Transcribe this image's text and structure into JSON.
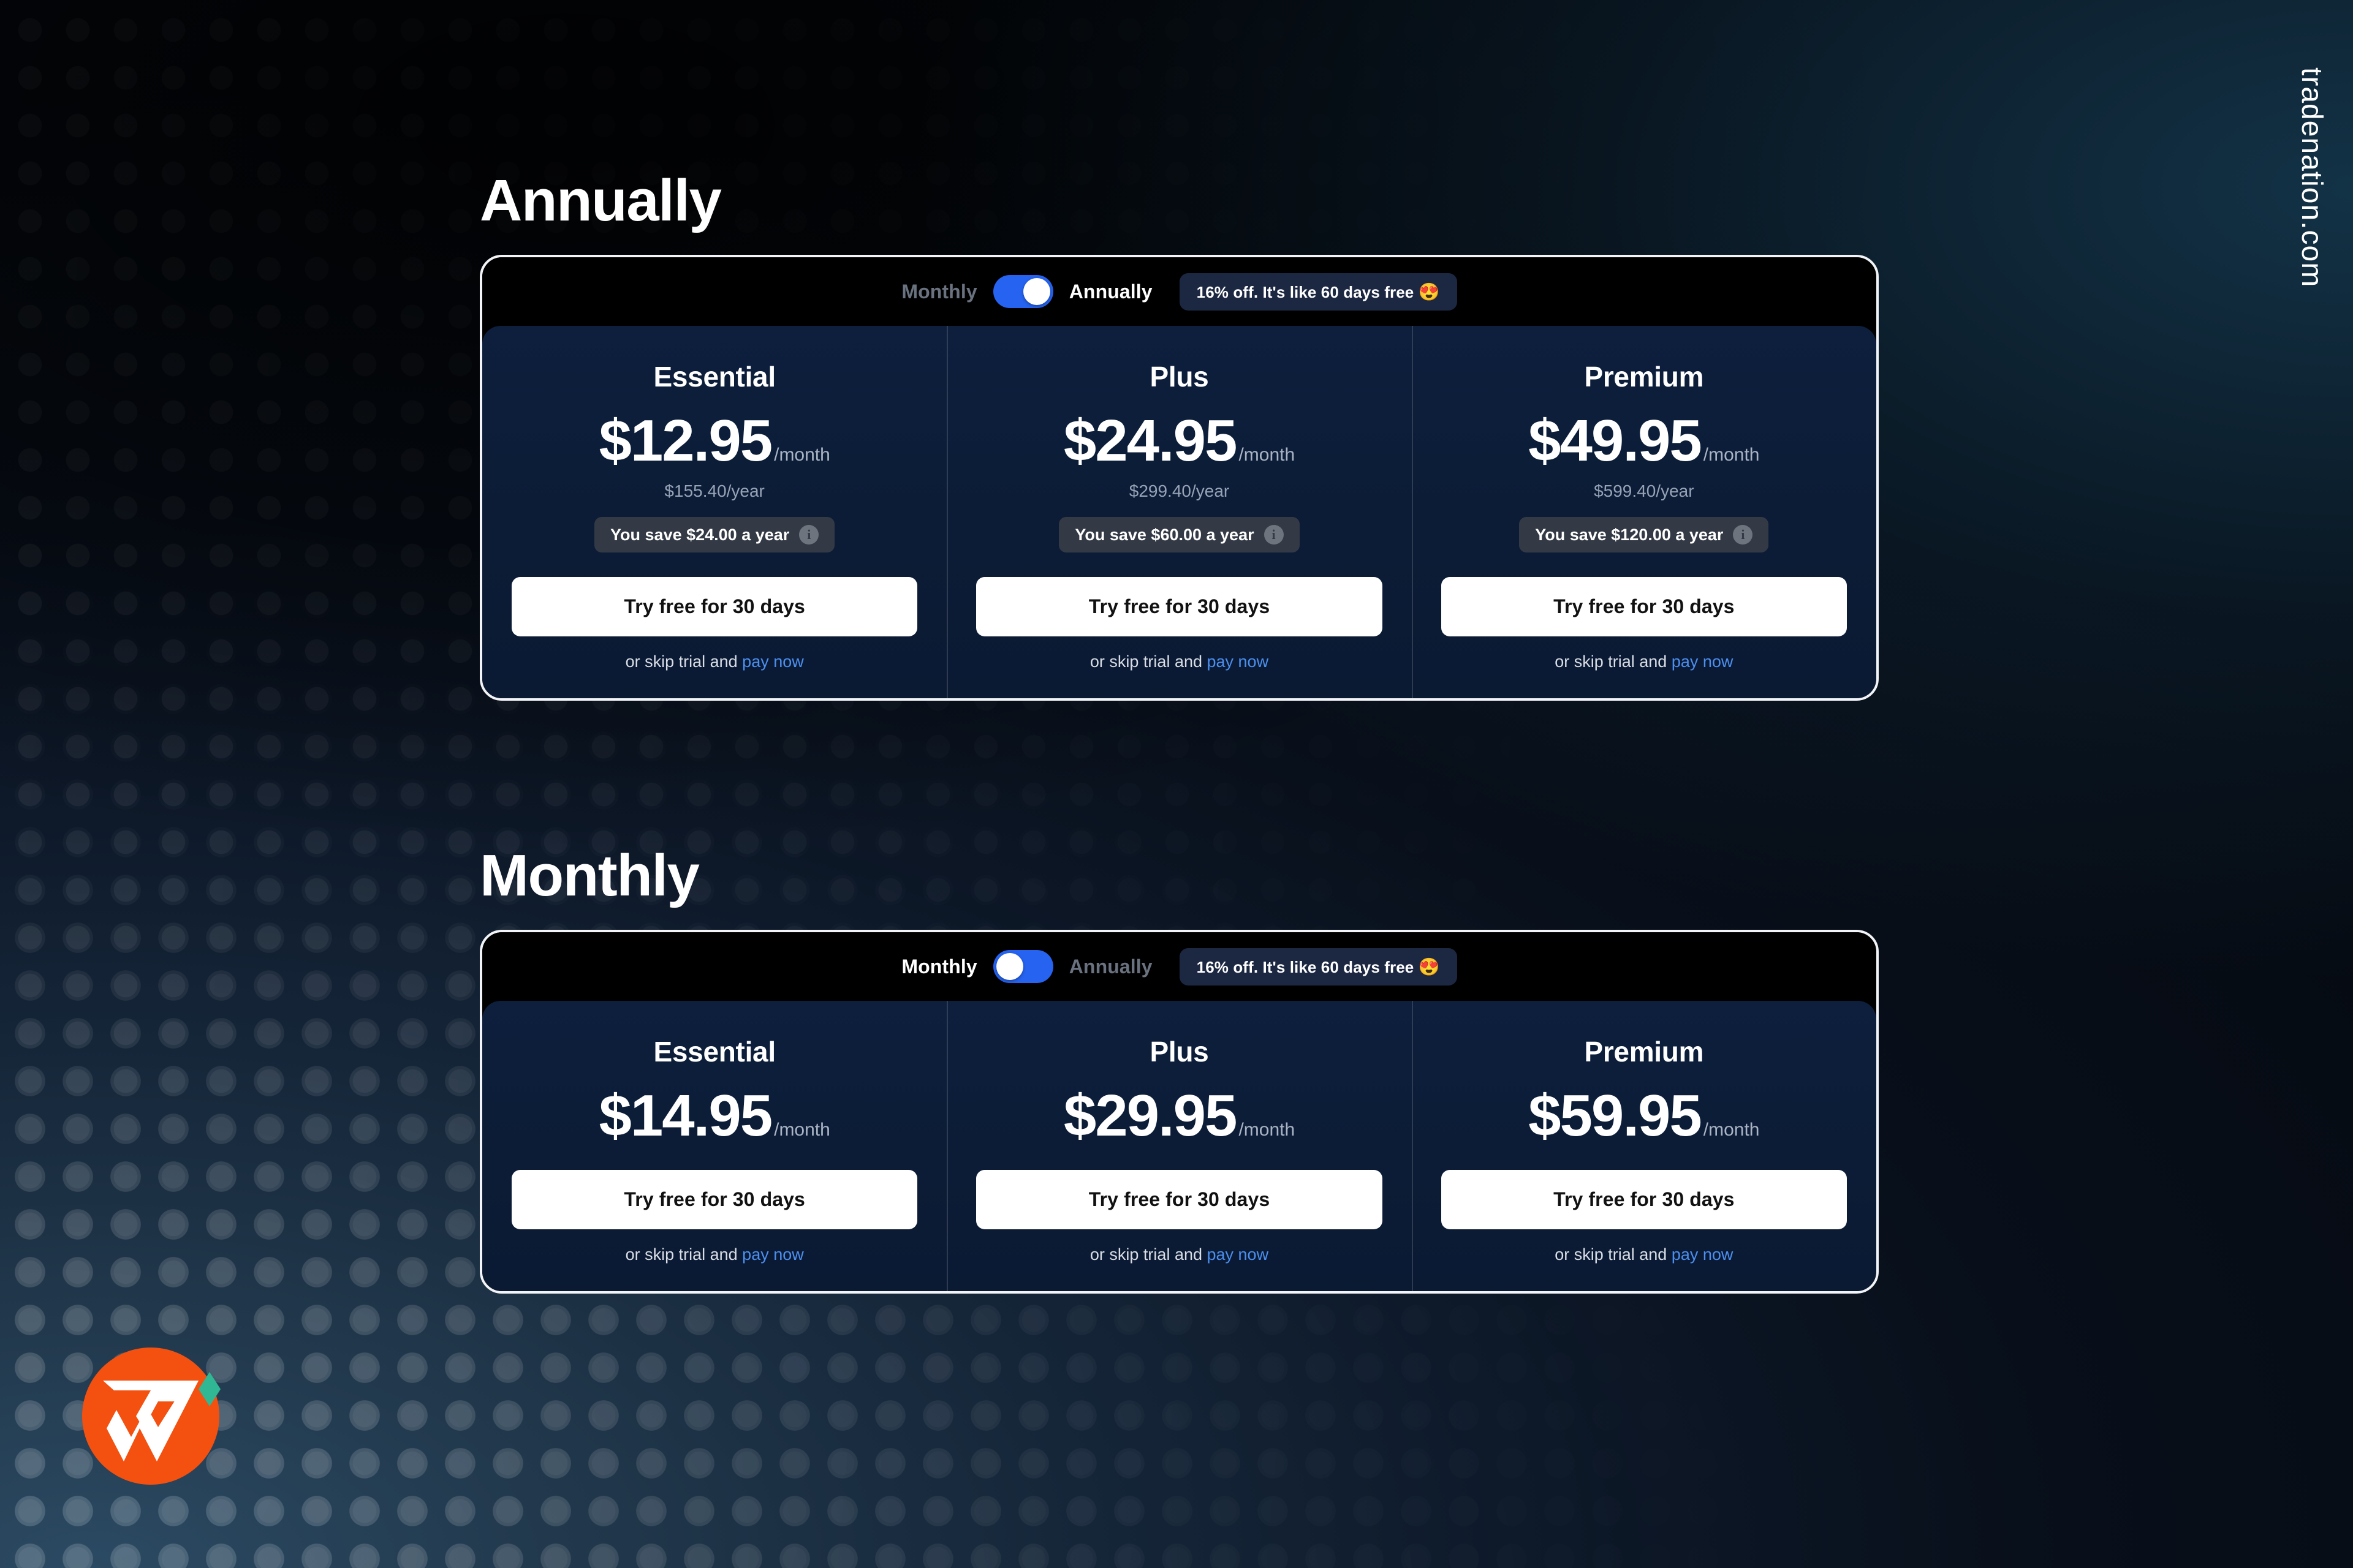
{
  "site_label": "tradenation.com",
  "logo": {
    "name": "tradenation-logo",
    "monogram": "TN",
    "circle_color": "#f4500f",
    "accent_color": "#2fb893"
  },
  "colors": {
    "accent_blue": "#2563f0",
    "link_blue": "#4b8ff0",
    "card_navy": "#0d1f3d",
    "toggle_bar_black": "#000000",
    "badge_navy": "#1c2742",
    "savings_gray": "#333a45",
    "cta_white": "#ffffff"
  },
  "sections": [
    {
      "heading": "Annually",
      "toggle": {
        "left_label": "Monthly",
        "right_label": "Annually",
        "state": "annually",
        "promo_badge": "16% off. It's like 60 days free",
        "promo_emoji": "😍"
      },
      "plans": [
        {
          "name": "Essential",
          "price": "$12.95",
          "period": "/month",
          "yearly": "$155.40/year",
          "savings": "You save $24.00 a year",
          "cta": "Try free for 30 days",
          "skip_prefix": "or skip trial and ",
          "skip_link": "pay now"
        },
        {
          "name": "Plus",
          "price": "$24.95",
          "period": "/month",
          "yearly": "$299.40/year",
          "savings": "You save $60.00 a year",
          "cta": "Try free for 30 days",
          "skip_prefix": "or skip trial and ",
          "skip_link": "pay now"
        },
        {
          "name": "Premium",
          "price": "$49.95",
          "period": "/month",
          "yearly": "$599.40/year",
          "savings": "You save $120.00 a year",
          "cta": "Try free for 30 days",
          "skip_prefix": "or skip trial and ",
          "skip_link": "pay now"
        }
      ]
    },
    {
      "heading": "Monthly",
      "toggle": {
        "left_label": "Monthly",
        "right_label": "Annually",
        "state": "monthly",
        "promo_badge": "16% off. It's like 60 days free",
        "promo_emoji": "😍"
      },
      "plans": [
        {
          "name": "Essential",
          "price": "$14.95",
          "period": "/month",
          "cta": "Try free for 30 days",
          "skip_prefix": "or skip trial and ",
          "skip_link": "pay now"
        },
        {
          "name": "Plus",
          "price": "$29.95",
          "period": "/month",
          "cta": "Try free for 30 days",
          "skip_prefix": "or skip trial and ",
          "skip_link": "pay now"
        },
        {
          "name": "Premium",
          "price": "$59.95",
          "period": "/month",
          "cta": "Try free for 30 days",
          "skip_prefix": "or skip trial and ",
          "skip_link": "pay now"
        }
      ]
    }
  ]
}
